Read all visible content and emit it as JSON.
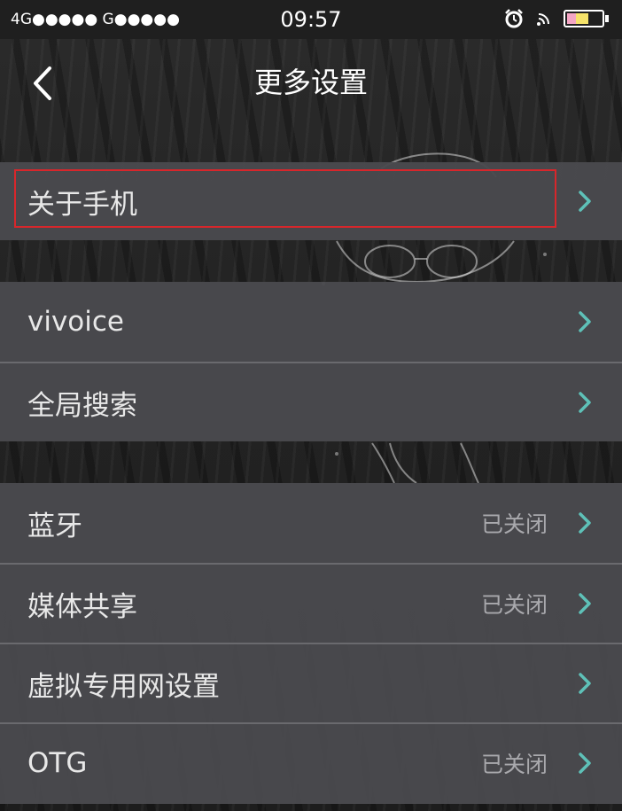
{
  "status_bar": {
    "signal_left": "4G●●●●● G●●●●●",
    "time": "09:57",
    "icons": [
      "alarm-icon",
      "nfc-icon",
      "battery-icon"
    ]
  },
  "header": {
    "title": "更多设置",
    "back_icon": "chevron-left-icon"
  },
  "colors": {
    "chevron": "#5ec1b8",
    "highlight_border": "#d8262b",
    "row_background": "#4a4a4e"
  },
  "groups": [
    {
      "items": [
        {
          "label": "关于手机",
          "status": "",
          "highlighted": true
        }
      ]
    },
    {
      "items": [
        {
          "label": "vivoice",
          "status": ""
        },
        {
          "label": "全局搜索",
          "status": ""
        }
      ]
    },
    {
      "items": [
        {
          "label": "蓝牙",
          "status": "已关闭"
        },
        {
          "label": "媒体共享",
          "status": "已关闭"
        },
        {
          "label": "虚拟专用网设置",
          "status": ""
        },
        {
          "label": "OTG",
          "status": "已关闭"
        }
      ]
    }
  ]
}
